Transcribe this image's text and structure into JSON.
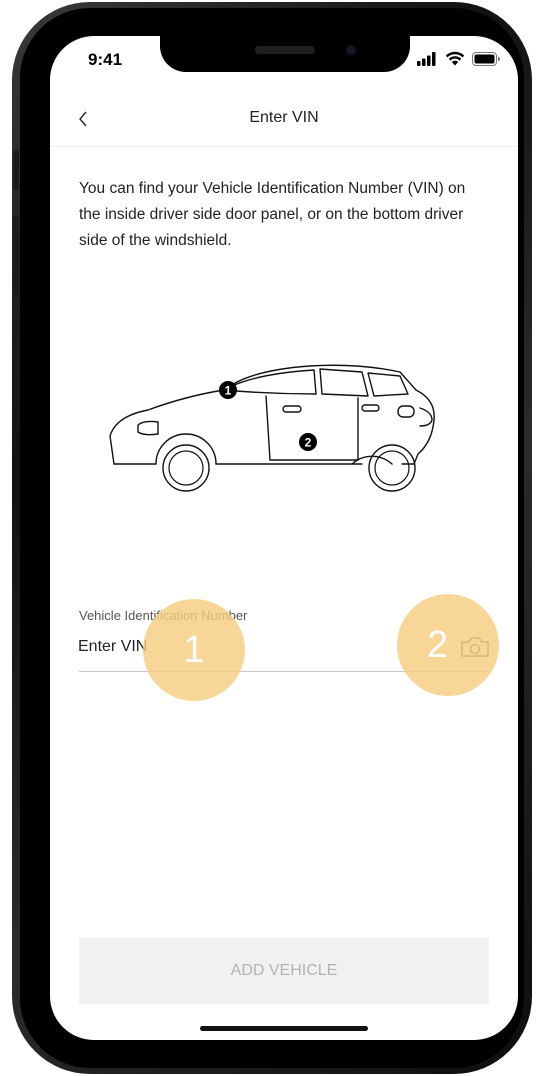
{
  "status_bar": {
    "time": "9:41"
  },
  "nav": {
    "title": "Enter VIN",
    "back_icon": "chevron-left-icon"
  },
  "intro_text": "You can find your Vehicle Identification Number (VIN) on the inside driver side door panel, or on the bottom driver side of the windshield.",
  "illustration": {
    "pins": [
      "1",
      "2"
    ]
  },
  "vin_field": {
    "label": "Vehicle Identification Number",
    "placeholder": "Enter VIN",
    "value": "",
    "icon": "camera-icon"
  },
  "markers": [
    "1",
    "2"
  ],
  "add_button": {
    "label": "ADD VEHICLE",
    "state": "disabled"
  },
  "colors": {
    "marker": "#F7CD80",
    "button_bg": "#F1F1F1",
    "button_text": "#B2B2B2"
  }
}
